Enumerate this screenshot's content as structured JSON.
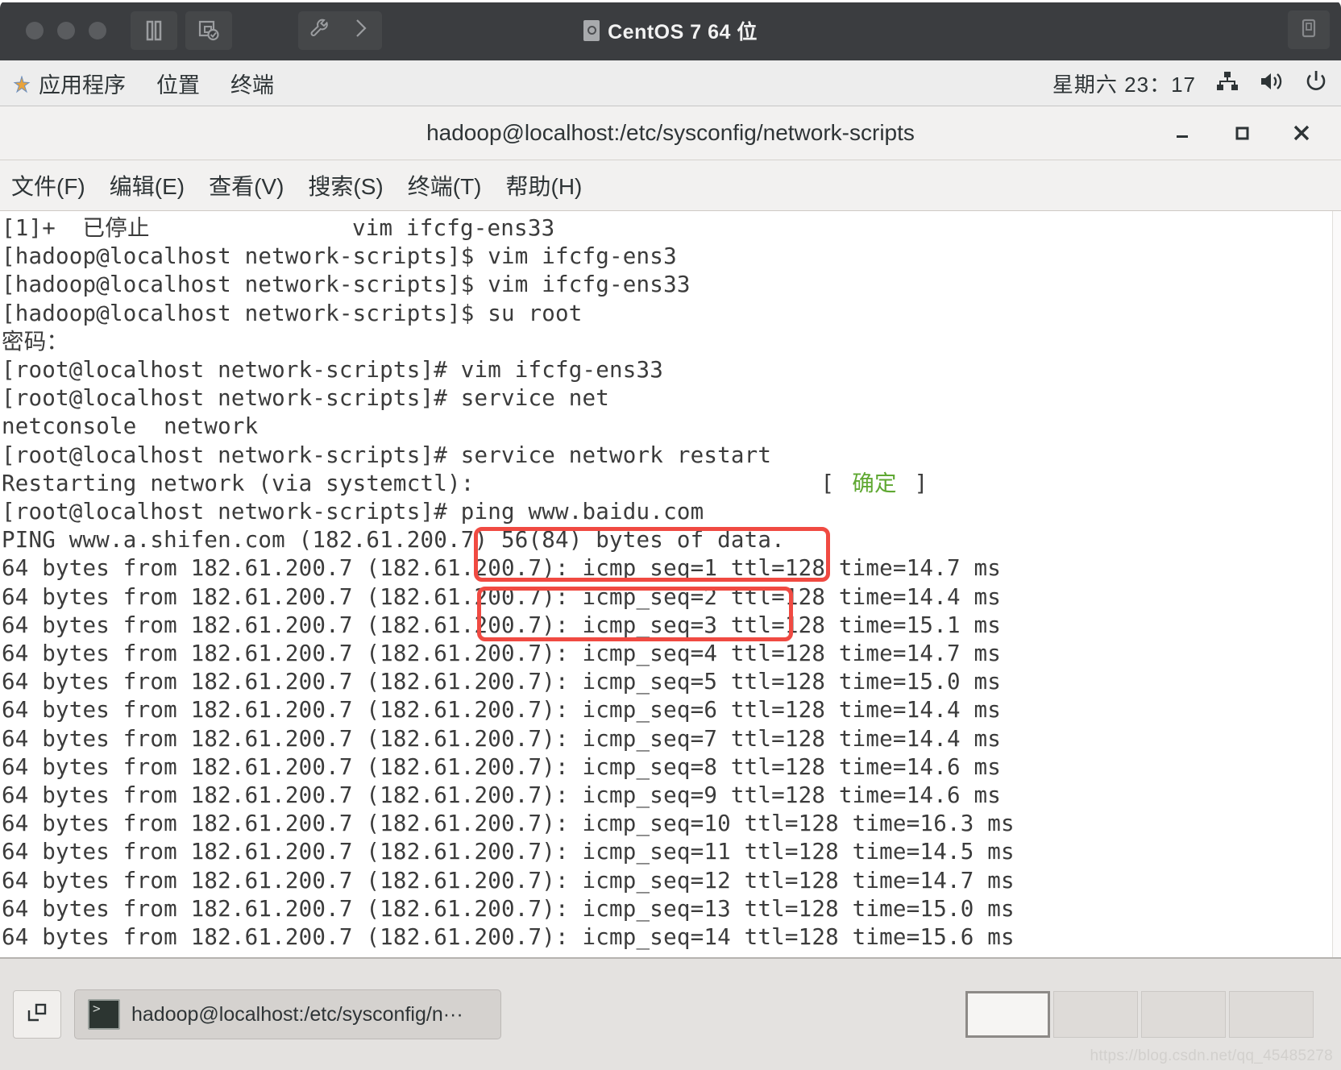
{
  "vm_window": {
    "title": "CentOS 7 64 位",
    "doc_icon": "document-icon",
    "traffic_lights": [
      "close-dot",
      "minimize-dot",
      "zoom-dot"
    ],
    "buttons": [
      {
        "name": "pause-button",
        "icon": "pause-icon"
      },
      {
        "name": "snapshot-button",
        "icon": "snapshot-icon"
      }
    ],
    "tools": [
      {
        "name": "settings-button",
        "icon": "wrench-icon"
      },
      {
        "name": "expand-button",
        "icon": "chevron-right-icon"
      }
    ],
    "right_button": {
      "name": "fullscreen-button",
      "icon": "unity-icon"
    }
  },
  "gnome_panel": {
    "menus": [
      {
        "label": "应用程序",
        "name": "applications-menu"
      },
      {
        "label": "位置",
        "name": "places-menu"
      },
      {
        "label": "终端",
        "name": "terminal-menu"
      }
    ],
    "clock": "星期六 23：17",
    "tray": [
      {
        "name": "network-icon"
      },
      {
        "name": "volume-icon"
      },
      {
        "name": "power-icon"
      }
    ]
  },
  "terminal_window": {
    "title": "hadoop@localhost:/etc/sysconfig/network-scripts",
    "window_controls": [
      {
        "name": "minimize-button",
        "glyph": "—"
      },
      {
        "name": "maximize-button",
        "glyph": "▫"
      },
      {
        "name": "close-button",
        "glyph": "✕"
      }
    ],
    "menubar": [
      {
        "label": "文件(F)",
        "name": "menu-file"
      },
      {
        "label": "编辑(E)",
        "name": "menu-edit"
      },
      {
        "label": "查看(V)",
        "name": "menu-view"
      },
      {
        "label": "搜索(S)",
        "name": "menu-search"
      },
      {
        "label": "终端(T)",
        "name": "menu-terminal"
      },
      {
        "label": "帮助(H)",
        "name": "menu-help"
      }
    ],
    "lines": [
      "[1]+  已停止               vim ifcfg-ens33",
      "[hadoop@localhost network-scripts]$ vim ifcfg-ens3",
      "[hadoop@localhost network-scripts]$ vim ifcfg-ens33",
      "[hadoop@localhost network-scripts]$ su root",
      "密码：",
      "[root@localhost network-scripts]# vim ifcfg-ens33",
      "[root@localhost network-scripts]# service net",
      "netconsole  network",
      "[root@localhost network-scripts]# service network restart",
      "Restarting network (via systemctl):",
      "[root@localhost network-scripts]# ping www.baidu.com",
      "PING www.a.shifen.com (182.61.200.7) 56(84) bytes of data.",
      "64 bytes from 182.61.200.7 (182.61.200.7): icmp_seq=1 ttl=128 time=14.7 ms",
      "64 bytes from 182.61.200.7 (182.61.200.7): icmp_seq=2 ttl=128 time=14.4 ms",
      "64 bytes from 182.61.200.7 (182.61.200.7): icmp_seq=3 ttl=128 time=15.1 ms",
      "64 bytes from 182.61.200.7 (182.61.200.7): icmp_seq=4 ttl=128 time=14.7 ms",
      "64 bytes from 182.61.200.7 (182.61.200.7): icmp_seq=5 ttl=128 time=15.0 ms",
      "64 bytes from 182.61.200.7 (182.61.200.7): icmp_seq=6 ttl=128 time=14.4 ms",
      "64 bytes from 182.61.200.7 (182.61.200.7): icmp_seq=7 ttl=128 time=14.4 ms",
      "64 bytes from 182.61.200.7 (182.61.200.7): icmp_seq=8 ttl=128 time=14.6 ms",
      "64 bytes from 182.61.200.7 (182.61.200.7): icmp_seq=9 ttl=128 time=14.6 ms",
      "64 bytes from 182.61.200.7 (182.61.200.7): icmp_seq=10 ttl=128 time=16.3 ms",
      "64 bytes from 182.61.200.7 (182.61.200.7): icmp_seq=11 ttl=128 time=14.5 ms",
      "64 bytes from 182.61.200.7 (182.61.200.7): icmp_seq=12 ttl=128 time=14.7 ms",
      "64 bytes from 182.61.200.7 (182.61.200.7): icmp_seq=13 ttl=128 time=15.0 ms",
      "64 bytes from 182.61.200.7 (182.61.200.7): icmp_seq=14 ttl=128 time=15.6 ms"
    ],
    "status_ok": {
      "bracket_open": "[",
      "label": "确定",
      "bracket_close": "]",
      "color": "#5fa832"
    },
    "annotations": [
      {
        "name": "highlight-service-network-restart",
        "color": "#f04a42"
      },
      {
        "name": "highlight-ping-baidu",
        "color": "#f04a42"
      }
    ]
  },
  "taskbar": {
    "show_desktop": {
      "name": "show-desktop-button",
      "icon": "windows-icon"
    },
    "task": {
      "label": "hadoop@localhost:/etc/sysconfig/n···",
      "icon": "terminal-icon"
    },
    "workspaces": [
      {
        "name": "workspace-1",
        "active": true
      },
      {
        "name": "workspace-2",
        "active": false
      },
      {
        "name": "workspace-3",
        "active": false
      },
      {
        "name": "workspace-4",
        "active": false
      }
    ]
  },
  "watermark": "https://blog.csdn.net/qq_45485278"
}
